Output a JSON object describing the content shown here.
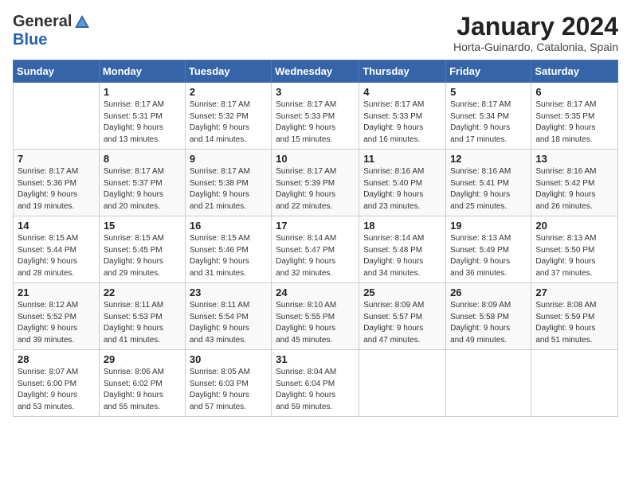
{
  "header": {
    "logo_general": "General",
    "logo_blue": "Blue",
    "month_title": "January 2024",
    "subtitle": "Horta-Guinardo, Catalonia, Spain"
  },
  "weekdays": [
    "Sunday",
    "Monday",
    "Tuesday",
    "Wednesday",
    "Thursday",
    "Friday",
    "Saturday"
  ],
  "weeks": [
    [
      {
        "day": "",
        "detail": ""
      },
      {
        "day": "1",
        "detail": "Sunrise: 8:17 AM\nSunset: 5:31 PM\nDaylight: 9 hours\nand 13 minutes."
      },
      {
        "day": "2",
        "detail": "Sunrise: 8:17 AM\nSunset: 5:32 PM\nDaylight: 9 hours\nand 14 minutes."
      },
      {
        "day": "3",
        "detail": "Sunrise: 8:17 AM\nSunset: 5:33 PM\nDaylight: 9 hours\nand 15 minutes."
      },
      {
        "day": "4",
        "detail": "Sunrise: 8:17 AM\nSunset: 5:33 PM\nDaylight: 9 hours\nand 16 minutes."
      },
      {
        "day": "5",
        "detail": "Sunrise: 8:17 AM\nSunset: 5:34 PM\nDaylight: 9 hours\nand 17 minutes."
      },
      {
        "day": "6",
        "detail": "Sunrise: 8:17 AM\nSunset: 5:35 PM\nDaylight: 9 hours\nand 18 minutes."
      }
    ],
    [
      {
        "day": "7",
        "detail": "Sunrise: 8:17 AM\nSunset: 5:36 PM\nDaylight: 9 hours\nand 19 minutes."
      },
      {
        "day": "8",
        "detail": "Sunrise: 8:17 AM\nSunset: 5:37 PM\nDaylight: 9 hours\nand 20 minutes."
      },
      {
        "day": "9",
        "detail": "Sunrise: 8:17 AM\nSunset: 5:38 PM\nDaylight: 9 hours\nand 21 minutes."
      },
      {
        "day": "10",
        "detail": "Sunrise: 8:17 AM\nSunset: 5:39 PM\nDaylight: 9 hours\nand 22 minutes."
      },
      {
        "day": "11",
        "detail": "Sunrise: 8:16 AM\nSunset: 5:40 PM\nDaylight: 9 hours\nand 23 minutes."
      },
      {
        "day": "12",
        "detail": "Sunrise: 8:16 AM\nSunset: 5:41 PM\nDaylight: 9 hours\nand 25 minutes."
      },
      {
        "day": "13",
        "detail": "Sunrise: 8:16 AM\nSunset: 5:42 PM\nDaylight: 9 hours\nand 26 minutes."
      }
    ],
    [
      {
        "day": "14",
        "detail": "Sunrise: 8:15 AM\nSunset: 5:44 PM\nDaylight: 9 hours\nand 28 minutes."
      },
      {
        "day": "15",
        "detail": "Sunrise: 8:15 AM\nSunset: 5:45 PM\nDaylight: 9 hours\nand 29 minutes."
      },
      {
        "day": "16",
        "detail": "Sunrise: 8:15 AM\nSunset: 5:46 PM\nDaylight: 9 hours\nand 31 minutes."
      },
      {
        "day": "17",
        "detail": "Sunrise: 8:14 AM\nSunset: 5:47 PM\nDaylight: 9 hours\nand 32 minutes."
      },
      {
        "day": "18",
        "detail": "Sunrise: 8:14 AM\nSunset: 5:48 PM\nDaylight: 9 hours\nand 34 minutes."
      },
      {
        "day": "19",
        "detail": "Sunrise: 8:13 AM\nSunset: 5:49 PM\nDaylight: 9 hours\nand 36 minutes."
      },
      {
        "day": "20",
        "detail": "Sunrise: 8:13 AM\nSunset: 5:50 PM\nDaylight: 9 hours\nand 37 minutes."
      }
    ],
    [
      {
        "day": "21",
        "detail": "Sunrise: 8:12 AM\nSunset: 5:52 PM\nDaylight: 9 hours\nand 39 minutes."
      },
      {
        "day": "22",
        "detail": "Sunrise: 8:11 AM\nSunset: 5:53 PM\nDaylight: 9 hours\nand 41 minutes."
      },
      {
        "day": "23",
        "detail": "Sunrise: 8:11 AM\nSunset: 5:54 PM\nDaylight: 9 hours\nand 43 minutes."
      },
      {
        "day": "24",
        "detail": "Sunrise: 8:10 AM\nSunset: 5:55 PM\nDaylight: 9 hours\nand 45 minutes."
      },
      {
        "day": "25",
        "detail": "Sunrise: 8:09 AM\nSunset: 5:57 PM\nDaylight: 9 hours\nand 47 minutes."
      },
      {
        "day": "26",
        "detail": "Sunrise: 8:09 AM\nSunset: 5:58 PM\nDaylight: 9 hours\nand 49 minutes."
      },
      {
        "day": "27",
        "detail": "Sunrise: 8:08 AM\nSunset: 5:59 PM\nDaylight: 9 hours\nand 51 minutes."
      }
    ],
    [
      {
        "day": "28",
        "detail": "Sunrise: 8:07 AM\nSunset: 6:00 PM\nDaylight: 9 hours\nand 53 minutes."
      },
      {
        "day": "29",
        "detail": "Sunrise: 8:06 AM\nSunset: 6:02 PM\nDaylight: 9 hours\nand 55 minutes."
      },
      {
        "day": "30",
        "detail": "Sunrise: 8:05 AM\nSunset: 6:03 PM\nDaylight: 9 hours\nand 57 minutes."
      },
      {
        "day": "31",
        "detail": "Sunrise: 8:04 AM\nSunset: 6:04 PM\nDaylight: 9 hours\nand 59 minutes."
      },
      {
        "day": "",
        "detail": ""
      },
      {
        "day": "",
        "detail": ""
      },
      {
        "day": "",
        "detail": ""
      }
    ]
  ]
}
